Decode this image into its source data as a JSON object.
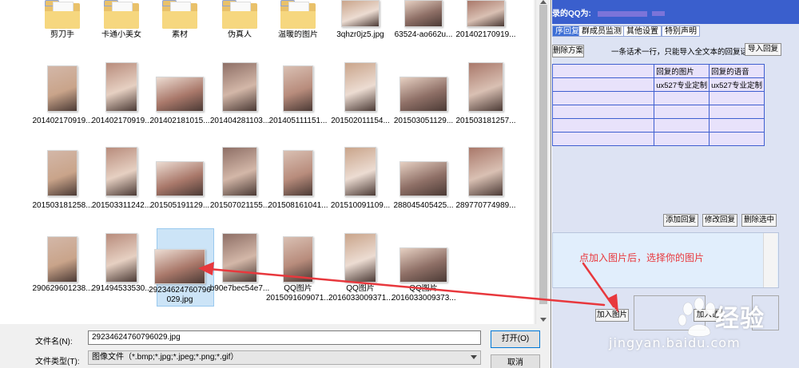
{
  "dialog": {
    "files": [
      {
        "name": "剪刀手",
        "kind": "folder"
      },
      {
        "name": "卡通小美女",
        "kind": "folder"
      },
      {
        "name": "素材",
        "kind": "folder"
      },
      {
        "name": "伪真人",
        "kind": "folder"
      },
      {
        "name": "温暖的图片",
        "kind": "folder"
      },
      {
        "name": "3qhzr0jz5.jpg",
        "kind": "image"
      },
      {
        "name": "63524-ao662u...",
        "kind": "image"
      },
      {
        "name": "20140217091​9...",
        "kind": "image"
      },
      {
        "name": "201402170919...",
        "kind": "image"
      },
      {
        "name": "201402170919...",
        "kind": "image"
      },
      {
        "name": "201402181015...",
        "kind": "image"
      },
      {
        "name": "201404281103...",
        "kind": "image"
      },
      {
        "name": "201405111151...",
        "kind": "image"
      },
      {
        "name": "201502011154...",
        "kind": "image"
      },
      {
        "name": "201503051129...",
        "kind": "image"
      },
      {
        "name": "201503181257...",
        "kind": "image"
      },
      {
        "name": "201503181258...",
        "kind": "image"
      },
      {
        "name": "201503311242...",
        "kind": "image"
      },
      {
        "name": "201505191129...",
        "kind": "image"
      },
      {
        "name": "201507021155...",
        "kind": "image"
      },
      {
        "name": "201508161041...",
        "kind": "image"
      },
      {
        "name": "201510091109...",
        "kind": "image"
      },
      {
        "name": "288045405425...",
        "kind": "image"
      },
      {
        "name": "289770774989...",
        "kind": "image"
      },
      {
        "name": "290629601238...",
        "kind": "image"
      },
      {
        "name": "291494533530...",
        "kind": "image"
      },
      {
        "name": "29234624760796",
        "name2": "029.jpg",
        "kind": "image",
        "selected": true
      },
      {
        "name": "b90e7bec54e7...",
        "kind": "image"
      },
      {
        "name": "QQ图片",
        "name2": "2015091609071...",
        "kind": "image"
      },
      {
        "name": "QQ图片",
        "name2": "2016033009371...",
        "kind": "image"
      },
      {
        "name": "QQ图片",
        "name2": "2016033009373...",
        "kind": "image"
      }
    ],
    "filename_label": "文件名(N):",
    "filename_value": "29234624760796029.jpg",
    "filetype_label": "文件类型(T):",
    "filetype_value": "图像文件（*.bmp;*.jpg;*.jpeg;*.png;*.gif）",
    "open_label": "打开(O)",
    "cancel_label": "取消"
  },
  "app": {
    "qq_label": "录的QQ为:",
    "tabs": [
      "序回复",
      "群成员监测",
      "其他设置",
      "特别声明"
    ],
    "delete_plan_label": "删除方案",
    "hint": "一条话术一行，只能导入全文本的回复话术",
    "import_reply_label": "导入回复",
    "table_headers": [
      "",
      "回复的图片",
      "回复的语音"
    ],
    "table_rows": [
      [
        "",
        "ux527专业定制",
        "ux527专业定制"
      ],
      [
        "",
        "",
        ""
      ],
      [
        "",
        "",
        ""
      ],
      [
        "",
        "",
        ""
      ],
      [
        "",
        "",
        ""
      ]
    ],
    "add_reply_label": "添加回复",
    "edit_reply_label": "修改回复",
    "delete_selected_label": "删除选中",
    "annotation": "点加入图片后，选择你的图片",
    "add_image_label": "加入图片",
    "add_voice_label": "加入语"
  },
  "watermark": {
    "brand": "经验",
    "url": "jingyan.baidu.com"
  },
  "colors": {
    "accent_blue": "#3a5fcd",
    "annotation_red": "#e8383d",
    "selection": "#cce4f7"
  }
}
